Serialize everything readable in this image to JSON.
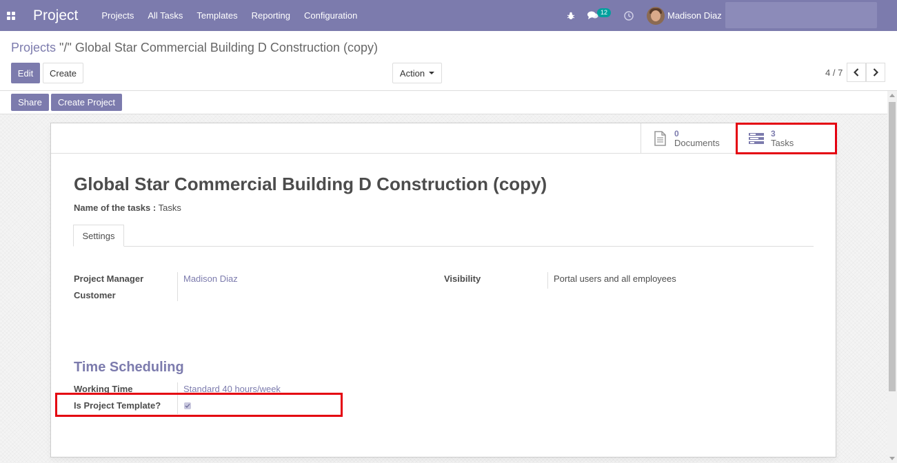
{
  "navbar": {
    "app_name": "Project",
    "menu": [
      "Projects",
      "All Tasks",
      "Templates",
      "Reporting",
      "Configuration"
    ],
    "messages_badge": "12",
    "user_name": "Madison Diaz",
    "icons": [
      "apps-grid-icon",
      "bug-icon",
      "chat-icon",
      "clock-icon"
    ],
    "accent_color": "#7c7bad"
  },
  "control_panel": {
    "breadcrumb_parent": "Projects",
    "breadcrumb_current": "\"/\" Global Star Commercial Building D Construction (copy)",
    "edit_label": "Edit",
    "create_label": "Create",
    "action_label": "Action",
    "pager": "4 / 7"
  },
  "statusbar": {
    "share_label": "Share",
    "create_project_label": "Create Project"
  },
  "smart_buttons": {
    "documents_count": "0",
    "documents_label": "Documents",
    "tasks_count": "3",
    "tasks_label": "Tasks"
  },
  "form": {
    "title": "Global Star Commercial Building D Construction (copy)",
    "tasks_name_label": "Name of the tasks :",
    "tasks_name_value": "Tasks",
    "tab_settings": "Settings",
    "project_manager_label": "Project Manager",
    "project_manager_value": "Madison Diaz",
    "customer_label": "Customer",
    "visibility_label": "Visibility",
    "visibility_value": "Portal users and all employees",
    "time_scheduling_title": "Time Scheduling",
    "working_time_label": "Working Time",
    "working_time_value": "Standard 40 hours/week",
    "is_template_label": "Is Project Template?",
    "is_template_checked": true
  },
  "highlight_color": "#e4000f"
}
